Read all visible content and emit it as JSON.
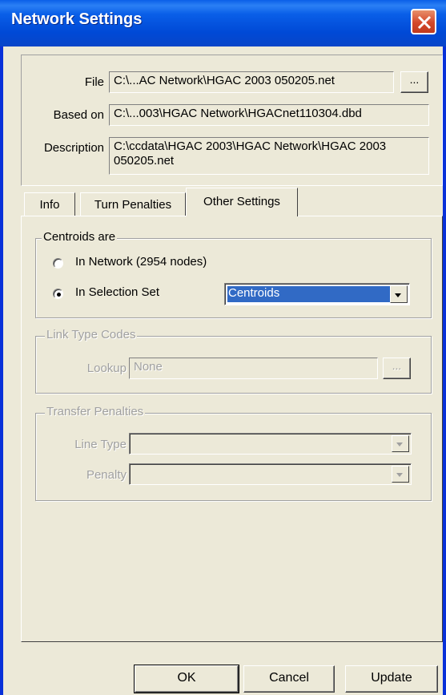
{
  "window": {
    "title": "Network Settings",
    "close_icon": "close-icon"
  },
  "header": {
    "file_label": "File",
    "file_value": "C:\\...AC Network\\HGAC 2003 050205.net",
    "browse_label": "...",
    "based_on_label": "Based on",
    "based_on_value": "C:\\...003\\HGAC Network\\HGACnet110304.dbd",
    "description_label": "Description",
    "description_value": "C:\\ccdata\\HGAC 2003\\HGAC Network\\HGAC 2003 050205.net"
  },
  "tabs": [
    {
      "label": "Info"
    },
    {
      "label": "Turn Penalties"
    },
    {
      "label": "Other Settings",
      "active": true
    }
  ],
  "centroids": {
    "legend": "Centroids are",
    "option_network": "In Network (2954 nodes)",
    "option_selection": "In Selection Set",
    "selected_option": "In Selection Set",
    "selection_set_value": "Centroids"
  },
  "link_type_codes": {
    "legend": "Link Type Codes",
    "lookup_label": "Lookup",
    "lookup_value": "None",
    "browse_label": "..."
  },
  "transfer_penalties": {
    "legend": "Transfer Penalties",
    "line_type_label": "Line Type",
    "line_type_value": "",
    "penalty_label": "Penalty",
    "penalty_value": ""
  },
  "buttons": {
    "ok": "OK",
    "cancel": "Cancel",
    "update": "Update"
  },
  "colors": {
    "titlebar": "#0a5fe8",
    "selection": "#316ac5",
    "close": "#d4472a"
  }
}
